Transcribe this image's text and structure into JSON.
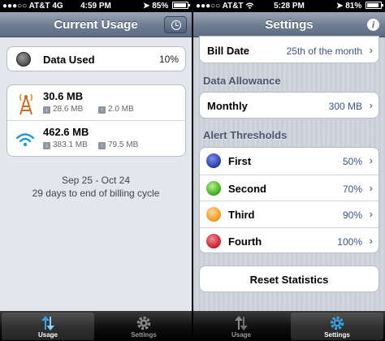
{
  "left": {
    "status": {
      "carrier": "AT&T",
      "network": "4G",
      "time": "4:59 PM",
      "battery": "85%",
      "battery_level": 0.85
    },
    "nav": {
      "title": "Current Usage",
      "clock_icon": "clock-icon"
    },
    "data_used": {
      "label": "Data Used",
      "value": "10%"
    },
    "cellular": {
      "total": "30.6 MB",
      "down": "28.6 MB",
      "up": "2.0 MB",
      "icon": "cell-tower-icon"
    },
    "wifi": {
      "total": "462.6 MB",
      "down": "383.1 MB",
      "up": "79.5 MB",
      "icon": "wifi-icon"
    },
    "period": {
      "range": "Sep 25 - Oct 24",
      "remaining": "29 days to end of billing cycle"
    },
    "tabs": [
      {
        "label": "Usage",
        "icon": "usage-arrows-icon",
        "active": true
      },
      {
        "label": "Settings",
        "icon": "gear-icon",
        "active": false
      }
    ]
  },
  "right": {
    "status": {
      "carrier": "AT&T",
      "network": "wifi",
      "time": "5:28 PM",
      "battery": "81%",
      "battery_level": 0.81
    },
    "nav": {
      "title": "Settings",
      "info_icon": "info-icon"
    },
    "bill_date": {
      "label": "Bill Date",
      "value": "25th of the month"
    },
    "allowance_section": "Data Allowance",
    "monthly": {
      "label": "Monthly",
      "value": "300 MB"
    },
    "alerts_section": "Alert Thresholds",
    "thresholds": [
      {
        "label": "First",
        "value": "50%",
        "color": "#2b3fa8"
      },
      {
        "label": "Second",
        "value": "70%",
        "color": "#3fae23"
      },
      {
        "label": "Third",
        "value": "90%",
        "color": "#f09a25"
      },
      {
        "label": "Fourth",
        "value": "100%",
        "color": "#c4262f"
      }
    ],
    "reset_label": "Reset Statistics",
    "tabs": [
      {
        "label": "Usage",
        "icon": "usage-arrows-icon",
        "active": false
      },
      {
        "label": "Settings",
        "icon": "gear-icon",
        "active": true
      }
    ]
  }
}
